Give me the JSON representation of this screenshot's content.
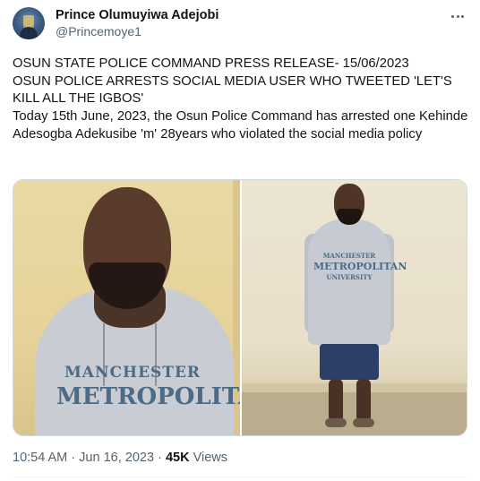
{
  "author": {
    "display_name": "Prince Olumuyiwa Adejobi",
    "handle": "@Princemoye1"
  },
  "tweet": {
    "lines": [
      "OSUN STATE POLICE COMMAND PRESS RELEASE- 15/06/2023",
      "OSUN POLICE ARRESTS SOCIAL MEDIA USER WHO TWEETED 'LET'S KILL ALL THE IGBOS'",
      "Today 15th June, 2023, the Osun Police Command has arrested one Kehinde Adesogba Adekusibe 'm' 28years who violated the social media policy"
    ]
  },
  "media": {
    "photo1_print": {
      "line1": "MANCHESTER",
      "line2": "METROPOLITAN"
    },
    "photo2_print": {
      "line1": "MANCHESTER",
      "line2": "METROPOLITAN",
      "line3": "UNIVERSITY"
    }
  },
  "meta": {
    "time": "10:54 AM",
    "separator": "·",
    "date": "Jun 16, 2023",
    "views_count": "45K",
    "views_label": "Views"
  },
  "icons": {
    "more": "more-horizontal-icon",
    "avatar": "user-avatar"
  },
  "colors": {
    "text_primary": "#0f1419",
    "text_secondary": "#536471",
    "border": "#cfd9de"
  }
}
